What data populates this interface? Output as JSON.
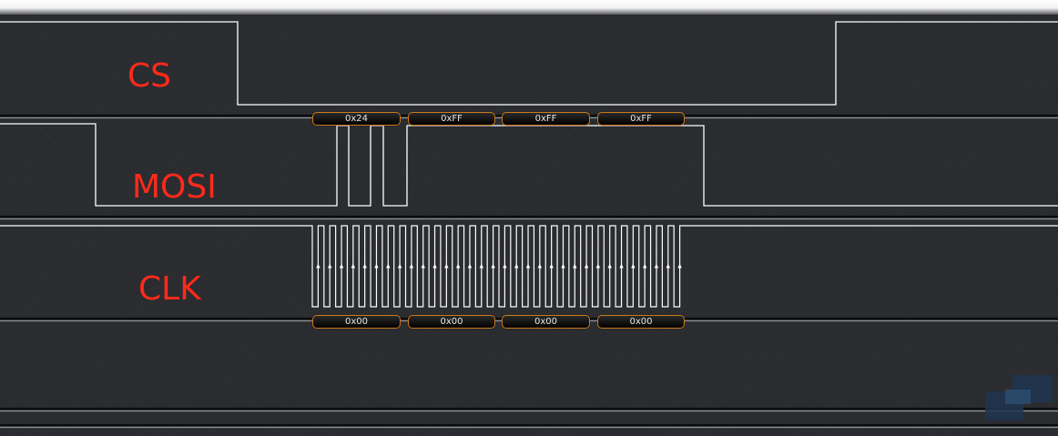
{
  "channels": {
    "cs": {
      "label": "CS"
    },
    "mosi": {
      "label": "MOSI"
    },
    "clk": {
      "label": "CLK"
    }
  },
  "decoded": {
    "mosi_bytes": [
      "0x24",
      "0xFF",
      "0xFF",
      "0xFF"
    ],
    "miso_bytes": [
      "0x00",
      "0x00",
      "0x00",
      "0x00"
    ]
  },
  "colors": {
    "background": "#2b2d31",
    "waveform": "#ffffff",
    "label": "#ff2a1a",
    "badge_border": "#d07a1a",
    "badge_fill": "#000000",
    "badge_text": "#e6e6e6"
  },
  "icons": {
    "clock_edge_marker": "arrow-up-icon",
    "watermark": "logo-mark-icon"
  }
}
